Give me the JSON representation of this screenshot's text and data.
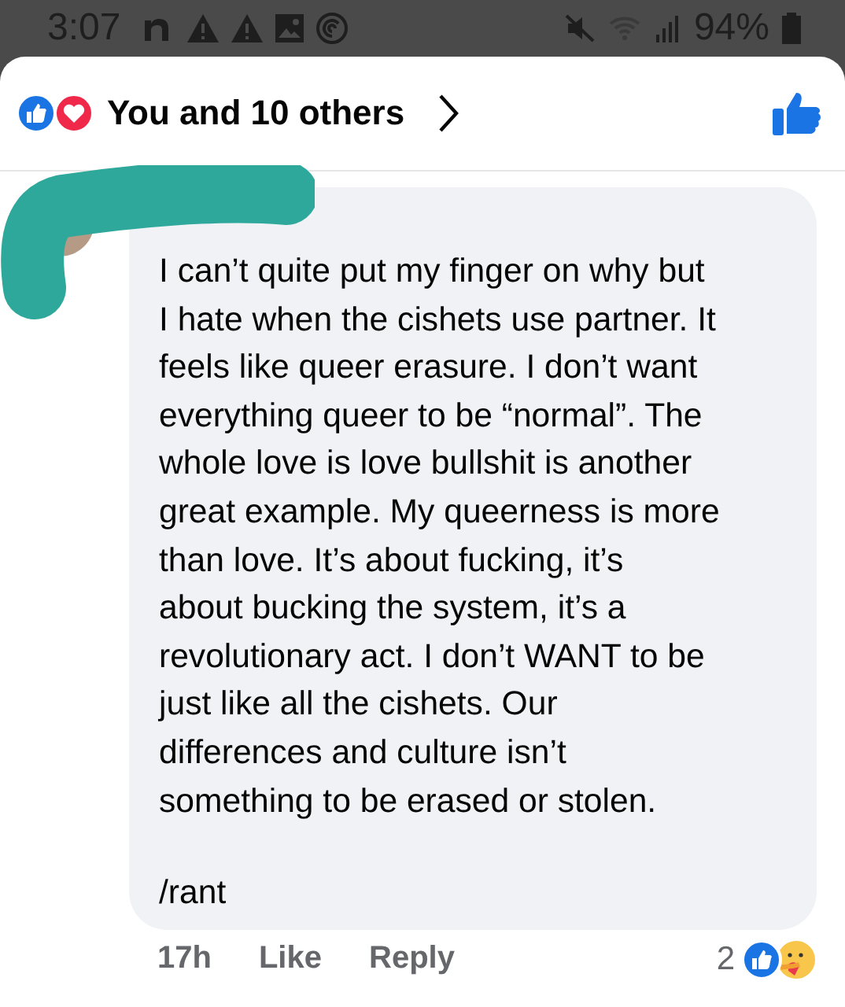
{
  "status_bar": {
    "time": "3:07",
    "battery": "94%"
  },
  "reactions_header": {
    "label": "You and 10 others",
    "liked": true
  },
  "comment": {
    "text": "I can’t quite put my finger on why but\nI hate when the cishets use partner. It\nfeels like queer erasure. I don’t want\neverything queer to be “normal”. The\nwhole love is love bullshit is another\ngreat example. My queerness is more\nthan love. It’s about fucking, it’s\nabout bucking the system, it’s a\nrevolutionary act. I don’t WANT to be\njust like all the cishets. Our\ndifferences and culture isn’t\nsomething to be erased or stolen.",
    "signoff": "/rant",
    "time": "17h",
    "like": "Like",
    "reply": "Reply",
    "reaction_count": "2"
  }
}
